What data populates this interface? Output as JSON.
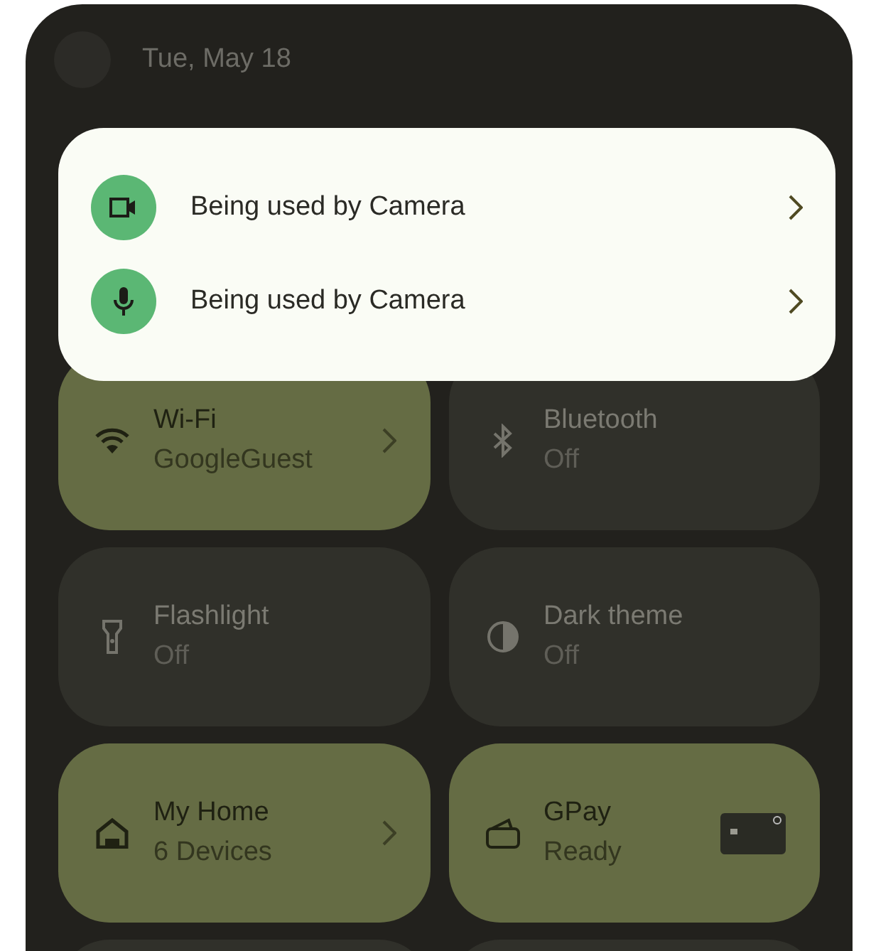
{
  "header": {
    "date": "Tue, May 18"
  },
  "privacy_popup": {
    "items": [
      {
        "kind": "camera",
        "label": "Being used by Camera"
      },
      {
        "kind": "microphone",
        "label": "Being used by Camera"
      }
    ]
  },
  "tiles": [
    {
      "kind": "wifi",
      "label": "Wi-Fi",
      "status": "GoogleGuest",
      "on": true,
      "chevron": true
    },
    {
      "kind": "bluetooth",
      "label": "Bluetooth",
      "status": "Off",
      "on": false
    },
    {
      "kind": "flashlight",
      "label": "Flashlight",
      "status": "Off",
      "on": false
    },
    {
      "kind": "dark_theme",
      "label": "Dark theme",
      "status": "Off",
      "on": false
    },
    {
      "kind": "home",
      "label": "My Home",
      "status": "6 Devices",
      "on": true,
      "chevron": true
    },
    {
      "kind": "wallet",
      "label": "GPay",
      "status": "Ready",
      "on": true,
      "card_preview": true
    }
  ]
}
